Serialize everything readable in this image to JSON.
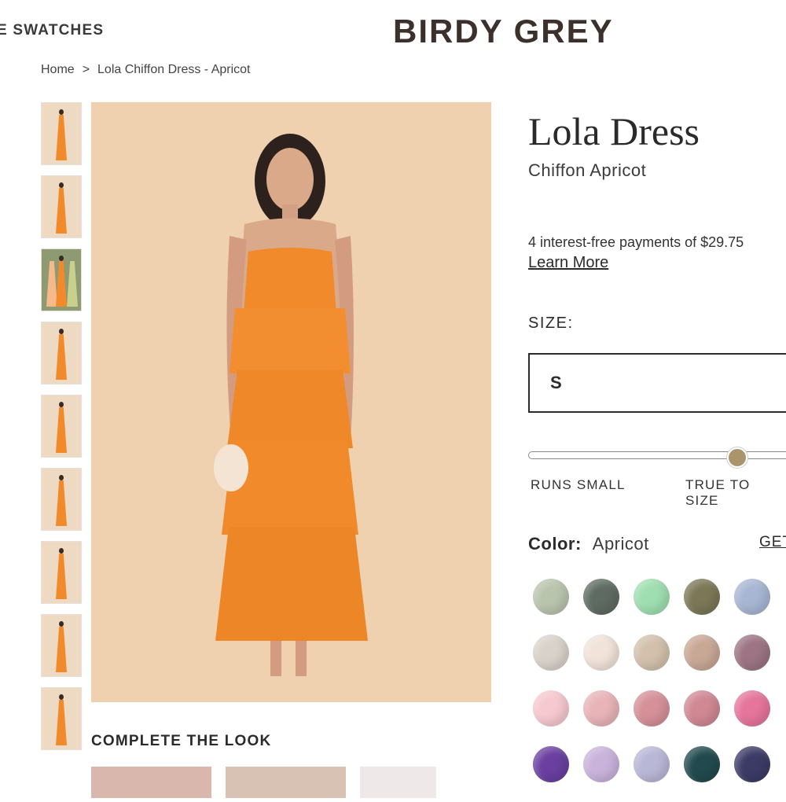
{
  "header": {
    "swatches_link": "E SWATCHES",
    "brand": "BIRDY GREY"
  },
  "breadcrumb": {
    "home": "Home",
    "separator": ">",
    "current": "Lola Chiffon Dress - Apricot"
  },
  "product": {
    "title": "Lola Dress",
    "subtitle": "Chiffon Apricot",
    "installments": "4 interest-free payments of $29.75",
    "learn_more": "Learn More",
    "size_label": "SIZE:",
    "size_value": "S",
    "fit": {
      "left_label": "RUNS SMALL",
      "mid_label": "TRUE TO SIZE",
      "position": 0.75
    },
    "color_label": "Color:",
    "color_value": "Apricot",
    "get_link": "GET"
  },
  "complete_the_look": {
    "heading": "COMPLETE THE LOOK"
  },
  "thumbnails_count": 9,
  "swatch_colors": [
    [
      "#b9c4ad",
      "#5e6b62",
      "#9fdeb0",
      "#7b7757",
      "#a7b6d3"
    ],
    [
      "#d9d2ca",
      "#f1e3da",
      "#d2c0ac",
      "#c9a795",
      "#9c7483"
    ],
    [
      "#f6c8cf",
      "#e8b4b8",
      "#d59098",
      "#d08893",
      "#e5759a"
    ],
    [
      "#6a3fa0",
      "#c9b3db",
      "#b9b7d6",
      "#224a4e",
      "#3c3b66"
    ]
  ],
  "colors": {
    "dress": "#f08a2a",
    "backdrop": "#efd1b0",
    "fit_knob": "#a9946b"
  }
}
